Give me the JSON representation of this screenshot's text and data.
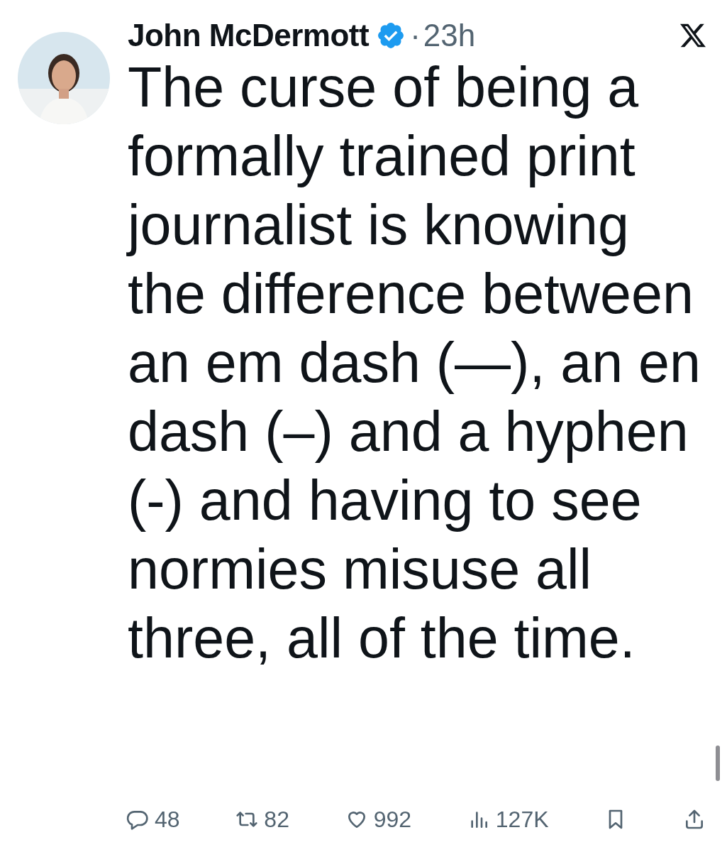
{
  "author": {
    "name": "John McDermott",
    "verified": true,
    "time": "23h",
    "separator": "·"
  },
  "text": "The curse of being a formally trained print journalist is knowing the difference between an em dash (—), an en dash (–) and a hyphen (-) and having to see normies misuse all three, all of the time.",
  "actions": [
    {
      "kind": "reply",
      "count": "48"
    },
    {
      "kind": "repost",
      "count": "82"
    },
    {
      "kind": "like",
      "count": "992"
    },
    {
      "kind": "views",
      "count": "127K"
    },
    {
      "kind": "bookmark"
    },
    {
      "kind": "share"
    }
  ]
}
